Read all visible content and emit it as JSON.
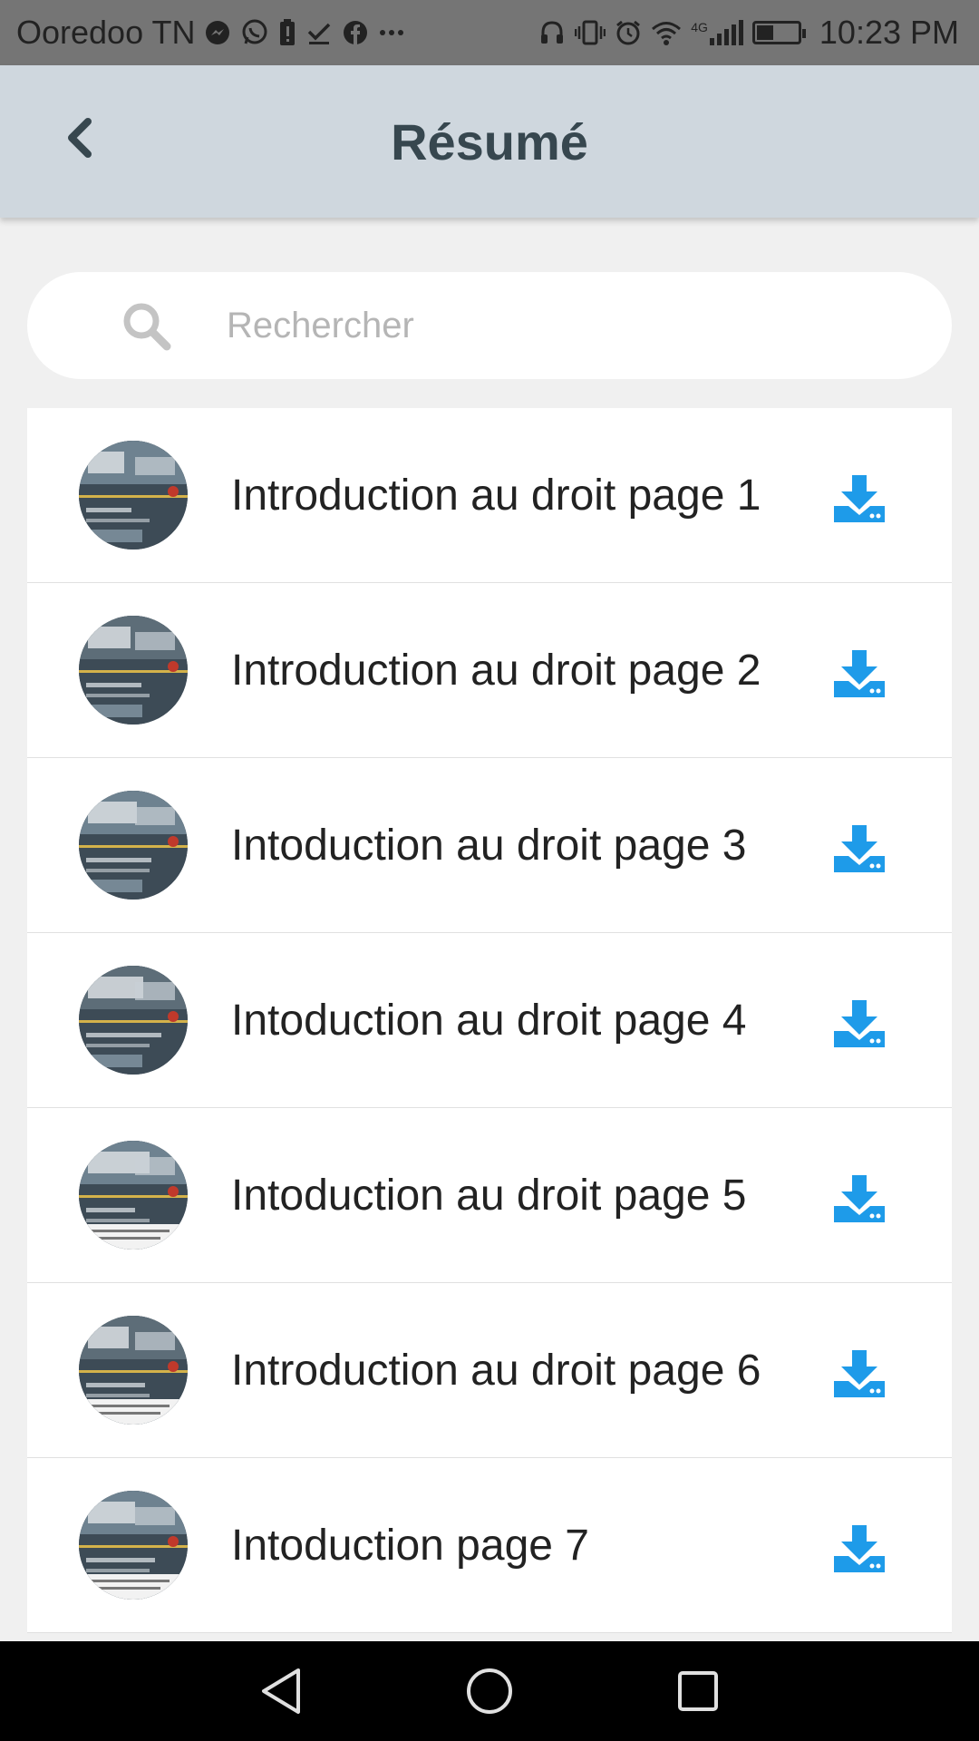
{
  "status_bar": {
    "carrier": "Ooredoo TN",
    "time": "10:23 PM",
    "network_label": "4G",
    "left_icons": [
      "messenger-icon",
      "whatsapp-icon",
      "battery-alert-icon",
      "check-download-icon",
      "facebook-icon",
      "more-icon"
    ],
    "right_icons": [
      "headphones-icon",
      "vibrate-icon",
      "alarm-icon",
      "wifi-icon",
      "signal-icon",
      "battery-icon"
    ],
    "battery_level": 0.4
  },
  "header": {
    "title": "Résumé",
    "back_icon": "chevron-left-icon"
  },
  "search": {
    "placeholder": "Rechercher",
    "value": "",
    "icon": "search-icon"
  },
  "items": [
    {
      "title": "Introduction au droit page 1"
    },
    {
      "title": "Introduction au droit page 2"
    },
    {
      "title": "Intoduction au droit page 3"
    },
    {
      "title": "Intoduction au droit page 4"
    },
    {
      "title": "Intoduction au droit page 5"
    },
    {
      "title": "Introduction au droit page 6"
    },
    {
      "title": "Intoduction page 7"
    }
  ],
  "colors": {
    "header_bg": "#cfd7de",
    "title_color": "#37474f",
    "download_accent": "#1e9be9",
    "page_bg": "#f0f0f0"
  },
  "nav": {
    "buttons": [
      "back-triangle-icon",
      "home-circle-icon",
      "recents-square-icon"
    ]
  }
}
